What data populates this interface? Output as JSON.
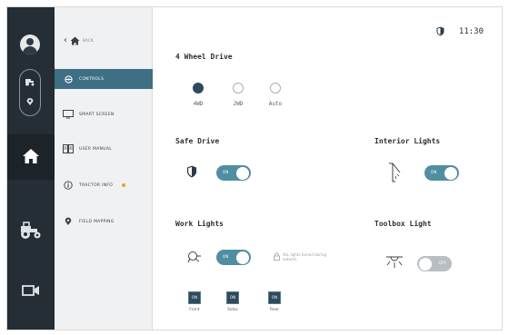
{
  "rail": {
    "icons": [
      "user-avatar-icon",
      "tractor-small-icon",
      "location-pin-icon",
      "home-icon",
      "tractor-icon",
      "camera-icon"
    ]
  },
  "menu": {
    "back_label": "BACK",
    "items": [
      {
        "label": "CONTROLS",
        "icon": "steering-wheel-icon",
        "active": true
      },
      {
        "label": "SMART SCREEN",
        "icon": "screen-icon",
        "active": false
      },
      {
        "label": "USER MANUAL",
        "icon": "manual-icon",
        "active": false
      },
      {
        "label": "TRACTOR INFO",
        "icon": "info-icon",
        "active": false,
        "badge_color": "#f0a023"
      },
      {
        "label": "FIELD MAPPING",
        "icon": "map-icon",
        "active": false
      }
    ]
  },
  "status": {
    "time": "11:30",
    "icon": "shield-icon"
  },
  "four_wheel_drive": {
    "title": "4 Wheel Drive",
    "options": [
      {
        "label": "4WD",
        "selected": true
      },
      {
        "label": "2WD",
        "selected": false
      },
      {
        "label": "Auto",
        "selected": false
      }
    ]
  },
  "safe_drive": {
    "title": "Safe Drive",
    "toggle_label": "ON",
    "state": "on"
  },
  "interior_lights": {
    "title": "Interior Lights",
    "toggle_label": "ON",
    "state": "on"
  },
  "work_lights": {
    "title": "Work Lights",
    "toggle_label": "ON",
    "state": "on",
    "note": "ALL lights turned during autumn",
    "zones": [
      {
        "label": "Front",
        "state": "ON"
      },
      {
        "label": "Sides",
        "state": "ON"
      },
      {
        "label": "Rear",
        "state": "ON"
      }
    ]
  },
  "toolbox_light": {
    "title": "Toolbox Light",
    "toggle_label": "OFF",
    "state": "off"
  },
  "colors": {
    "accent": "#4f8fa1",
    "active_menu": "#3f6f85",
    "rail": "#252d35",
    "badge": "#f0a023"
  }
}
